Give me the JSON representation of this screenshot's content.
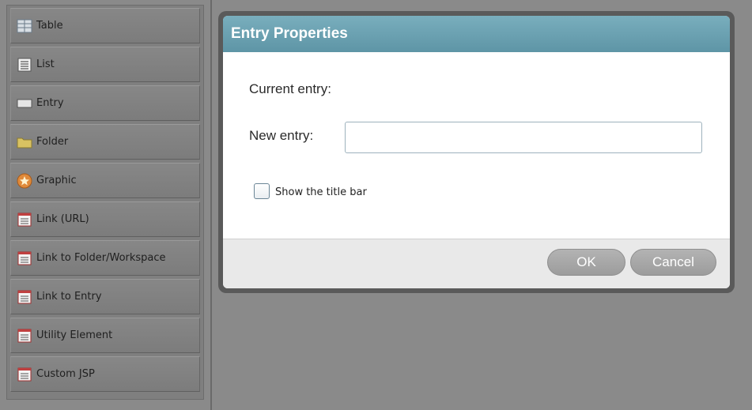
{
  "palette": {
    "items": [
      {
        "label": "Table",
        "icon": "table-icon"
      },
      {
        "label": "List",
        "icon": "list-icon"
      },
      {
        "label": "Entry",
        "icon": "entry-icon"
      },
      {
        "label": "Folder",
        "icon": "folder-icon"
      },
      {
        "label": "Graphic",
        "icon": "graphic-icon"
      },
      {
        "label": "Link (URL)",
        "icon": "link-url-icon"
      },
      {
        "label": "Link to Folder/Workspace",
        "icon": "link-folder-icon"
      },
      {
        "label": "Link to Entry",
        "icon": "link-entry-icon"
      },
      {
        "label": "Utility Element",
        "icon": "utility-icon"
      },
      {
        "label": "Custom JSP",
        "icon": "custom-jsp-icon"
      }
    ]
  },
  "dialog": {
    "title": "Entry Properties",
    "current_entry_label": "Current entry:",
    "new_entry_label": "New entry:",
    "new_entry_value": "",
    "show_title_bar_label": "Show the title bar",
    "show_title_bar_checked": false,
    "ok_label": "OK",
    "cancel_label": "Cancel"
  },
  "colors": {
    "title_bar": "#6aa3b3",
    "background": "#8a8a8a"
  }
}
